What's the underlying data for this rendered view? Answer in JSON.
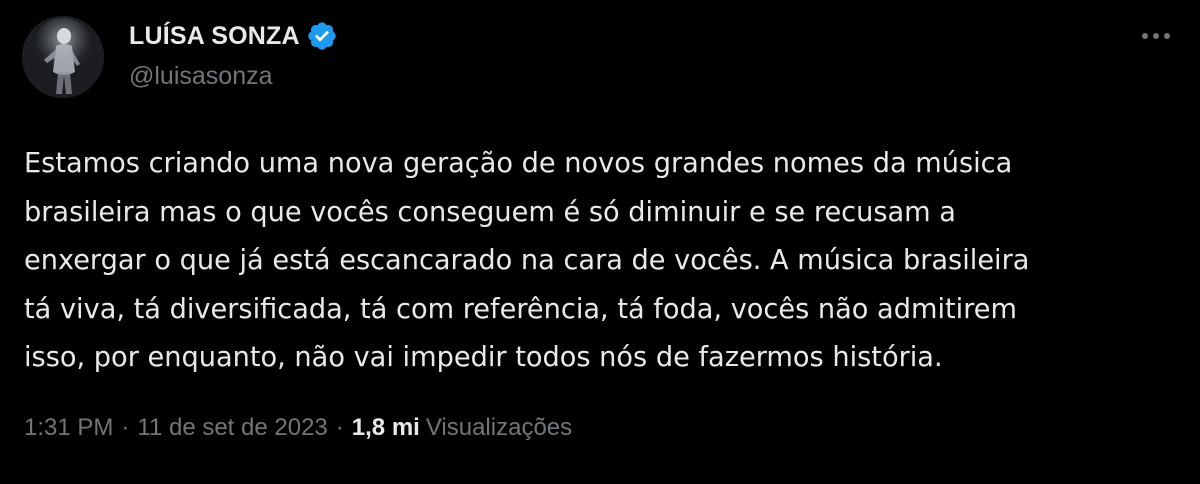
{
  "tweet": {
    "author": {
      "display_name": "LUÍSA SONZA",
      "handle": "@luisasonza",
      "verified": true
    },
    "text": "Estamos criando uma nova geração de novos grandes nomes da música\nbrasileira mas o que vocês conseguem é só diminuir e se recusam a\nenxergar o que já está escancarado na cara de vocês. A música brasileira\ntá viva, tá diversificada, tá com referência, tá foda, vocês não admitirem\nisso, por enquanto, não vai impedir todos nós de fazermos história.",
    "time": "1:31 PM",
    "date": "11 de set de 2023",
    "separator": "·",
    "views_count": "1,8 mi",
    "views_label": "Visualizações"
  },
  "icons": {
    "verified": "verified-badge-icon",
    "more": "more-options-icon"
  },
  "colors": {
    "background": "#000000",
    "text_primary": "#e7e9ea",
    "text_secondary": "#71767b",
    "verified_blue": "#1d9bf0"
  }
}
